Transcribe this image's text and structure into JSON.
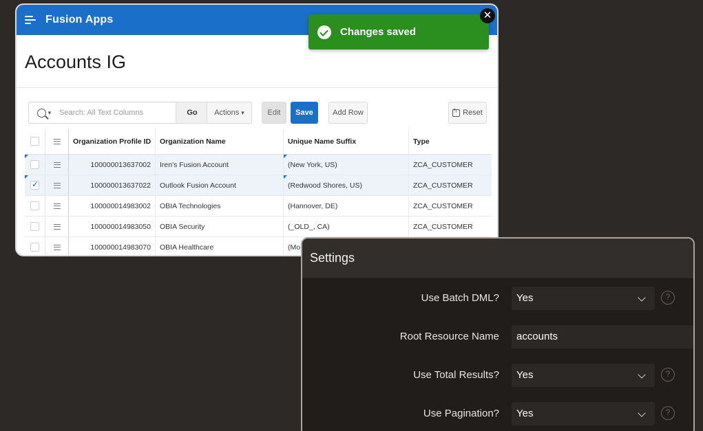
{
  "app": {
    "title": "Fusion Apps",
    "page_title": "Accounts IG"
  },
  "toolbar": {
    "search_placeholder": "Search: All Text Columns",
    "go_label": "Go",
    "actions_label": "Actions",
    "edit_label": "Edit",
    "save_label": "Save",
    "add_row_label": "Add Row",
    "reset_label": "Reset"
  },
  "grid": {
    "columns": [
      "Organization Profile ID",
      "Organization Name",
      "Unique Name Suffix",
      "Type"
    ],
    "rows": [
      {
        "id": "100000013637002",
        "name": "Iren's Fusion Account",
        "suffix": "(New York, US)",
        "type": "ZCA_CUSTOMER",
        "checked": false
      },
      {
        "id": "100000013637022",
        "name": "Outlook Fusion Account",
        "suffix": "(Redwood Shores, US)",
        "type": "ZCA_CUSTOMER",
        "checked": true
      },
      {
        "id": "100000014983002",
        "name": "OBIA Technologies",
        "suffix": "(Hannover, DE)",
        "type": "ZCA_CUSTOMER",
        "checked": false
      },
      {
        "id": "100000014983050",
        "name": "OBIA Security",
        "suffix": "(_OLD_, CA)",
        "type": "ZCA_CUSTOMER",
        "checked": false
      },
      {
        "id": "100000014983070",
        "name": "OBIA Healthcare",
        "suffix": "(Mo",
        "type": "",
        "checked": false
      }
    ]
  },
  "toast": {
    "message": "Changes saved",
    "color": "#2a8f1f"
  },
  "settings": {
    "title": "Settings",
    "fields": [
      {
        "label": "Use Batch DML?",
        "value": "Yes"
      },
      {
        "label": "Root Resource Name",
        "value": "accounts"
      },
      {
        "label": "Use Total Results?",
        "value": "Yes"
      },
      {
        "label": "Use Pagination?",
        "value": "Yes"
      }
    ]
  },
  "colors": {
    "header_blue": "#1a6fc9",
    "panel_dark": "#201d1b",
    "background": "#2c2927"
  },
  "icons": {
    "menu": "hamburger-icon",
    "search": "search-icon",
    "reset": "reset-icon",
    "toast": "check-circle-icon",
    "close": "close-icon",
    "help": "help-icon",
    "dropdown": "chevron-down-icon"
  }
}
